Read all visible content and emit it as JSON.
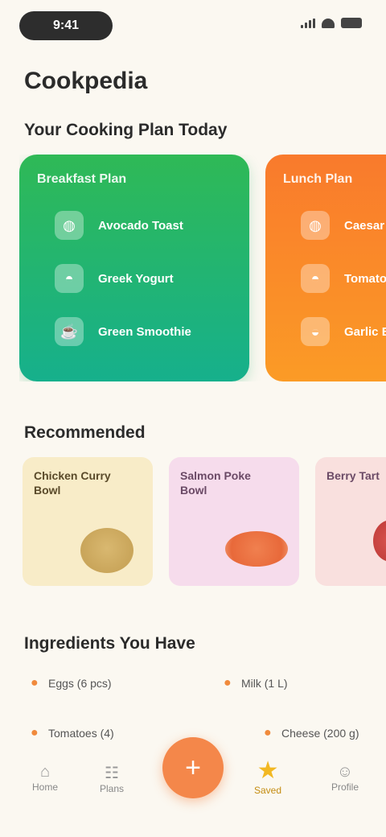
{
  "status": {
    "time": "9:41"
  },
  "page_title": "Cookpedia",
  "plans": {
    "title": "Your Cooking Plan Today",
    "cards": [
      {
        "title": "Breakfast Plan",
        "items": [
          {
            "icon": "egg-icon",
            "glyph": "◍",
            "label": "Avocado Toast"
          },
          {
            "icon": "bowl-icon",
            "glyph": "◓",
            "label": "Greek Yogurt"
          },
          {
            "icon": "cup-icon",
            "glyph": "☕",
            "label": "Green Smoothie"
          }
        ]
      },
      {
        "title": "Lunch Plan",
        "items": [
          {
            "icon": "salad-icon",
            "glyph": "◍",
            "label": "Caesar Salad"
          },
          {
            "icon": "soup-icon",
            "glyph": "◓",
            "label": "Tomato Soup"
          },
          {
            "icon": "bread-icon",
            "glyph": "◒",
            "label": "Garlic Bread"
          }
        ]
      }
    ]
  },
  "recommendations": {
    "title": "Recommended",
    "items": [
      {
        "name": "Chicken Curry Bowl"
      },
      {
        "name": "Salmon Poke Bowl"
      },
      {
        "name": "Berry Tart"
      }
    ]
  },
  "ingredients": {
    "title": "Ingredients You Have",
    "items": [
      {
        "label": "Eggs (6 pcs)"
      },
      {
        "label": "Milk (1 L)"
      },
      {
        "label": "Tomatoes (4)"
      },
      {
        "label": "Cheese (200 g)"
      }
    ]
  },
  "tabs": [
    {
      "label": "Home",
      "glyph": "⌂"
    },
    {
      "label": "Plans",
      "glyph": "☷"
    },
    {
      "label": "Add",
      "glyph": "+"
    },
    {
      "label": "Saved",
      "glyph": "★"
    },
    {
      "label": "Profile",
      "glyph": "☺"
    }
  ],
  "colors": {
    "background": "#fbf8f1",
    "green_card": "#16b08c",
    "orange_card": "#f97a2c",
    "fab": "#f4874a",
    "active_tab": "#f2b823"
  }
}
